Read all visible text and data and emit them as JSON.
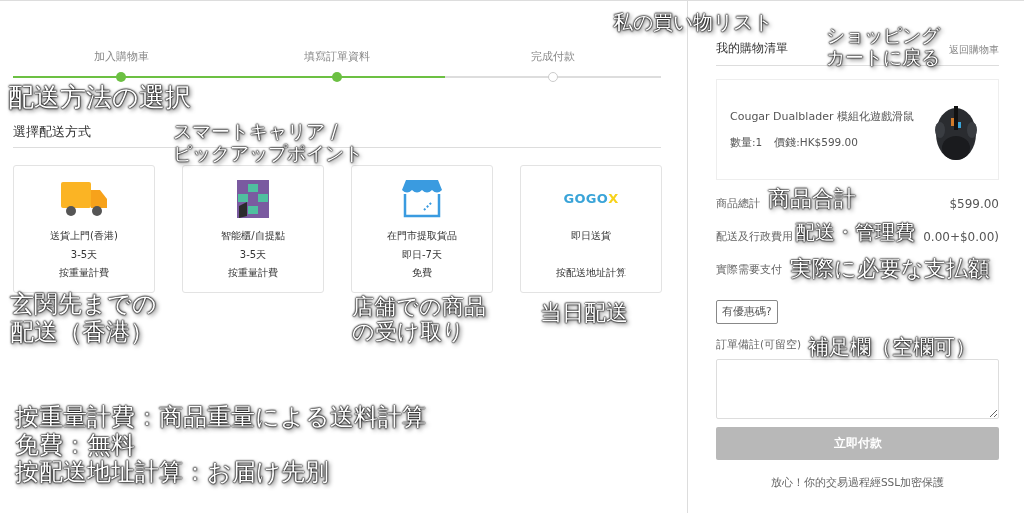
{
  "steps": [
    {
      "label": "加入購物車",
      "done": true
    },
    {
      "label": "填寫訂單資料",
      "done": true
    },
    {
      "label": "完成付款",
      "done": false
    }
  ],
  "shipping": {
    "title": "選擇配送方式",
    "options": [
      {
        "kind": "truck",
        "name": "送貨上門(香港)",
        "days": "3-5天",
        "fee": "按重量計費"
      },
      {
        "kind": "locker",
        "name": "智能櫃/自提點",
        "days": "3-5天",
        "fee": "按重量計費"
      },
      {
        "kind": "store",
        "name": "在門市提取貨品",
        "days": "即日-7天",
        "fee": "免費"
      },
      {
        "kind": "logo",
        "logo": "GOGO",
        "logo_mark": "X",
        "name": "即日送貨",
        "fee": "按配送地址計算"
      }
    ]
  },
  "cart": {
    "title": "我的購物清單",
    "back_link": "返回購物車",
    "item": {
      "name": "Cougar Dualblader 模組化遊戲滑鼠",
      "quantity": "數量:1",
      "price": "價錢:HK$599.00"
    },
    "summary": [
      {
        "label": "商品總計",
        "value": "$599.00"
      },
      {
        "label": "配送及行政費用",
        "value": "0.00+$0.00)"
      },
      {
        "label": "實際需要支付"
      }
    ],
    "coupon_button": "有優惠碼?",
    "note_label": "訂單備註(可留空)",
    "pay_button": {
      "label": "立即付款",
      "disabled": true
    },
    "footer": "放心！你的交易過程經SSL加密保護"
  },
  "annotations": [
    {
      "lines": [
        "私の買い物リスト"
      ]
    },
    {
      "lines": [
        "ショッピング",
        "カートに戻る"
      ]
    },
    {
      "lines": [
        "配送方法の選択"
      ]
    },
    {
      "lines": [
        "スマートキャリア /",
        "ピックアップポイント"
      ]
    },
    {
      "lines": [
        "玄関先までの",
        "配送（香港）"
      ]
    },
    {
      "lines": [
        "店舗での商品",
        "の受け取り"
      ]
    },
    {
      "lines": [
        "当日配送"
      ]
    },
    {
      "lines": [
        "商品合計"
      ]
    },
    {
      "lines": [
        "配送・管理費"
      ]
    },
    {
      "lines": [
        "実際に必要な支払額"
      ]
    },
    {
      "lines": [
        "補足欄（空欄可）"
      ]
    },
    {
      "lines": [
        "按重量計費：商品重量による送料計算",
        "免費：無料",
        "按配送地址計算：お届け先別"
      ]
    }
  ]
}
